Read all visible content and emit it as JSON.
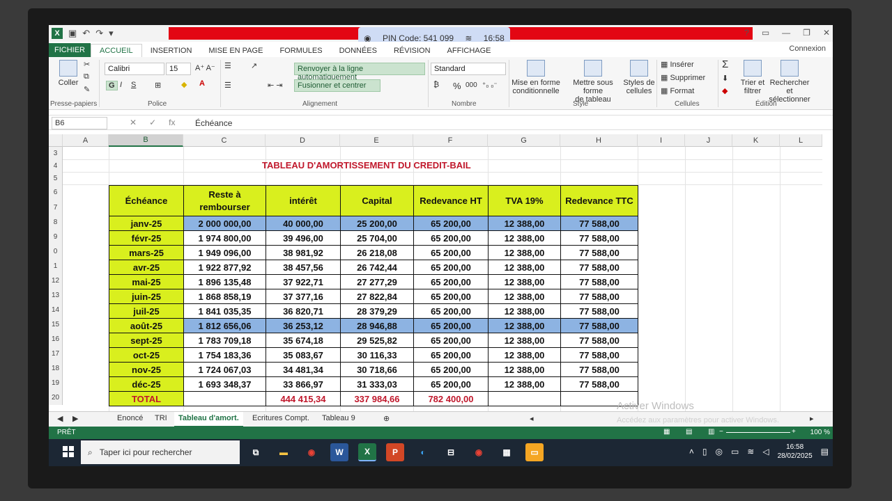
{
  "titlebar": {
    "pin_code": "PIN Code: 541 099",
    "pin_time": "16:58"
  },
  "tabs": [
    {
      "label": "FICHIER"
    },
    {
      "label": "ACCUEIL"
    },
    {
      "label": "INSERTION"
    },
    {
      "label": "MISE EN PAGE"
    },
    {
      "label": "FORMULES"
    },
    {
      "label": "DONNÉES"
    },
    {
      "label": "RÉVISION"
    },
    {
      "label": "AFFICHAGE"
    }
  ],
  "connexion": "Connexion",
  "ribbon": {
    "paste": "Coller",
    "clipboard": "Presse-papiers",
    "font_name": "Calibri",
    "font_size": "15",
    "font_group": "Police",
    "bold": "G",
    "italic": "I",
    "underline": "S",
    "wrap_text": "Renvoyer à la ligne automatiquement",
    "merge_center": "Fusionner et centrer",
    "alignment_group": "Alignement",
    "number_format": "Standard",
    "percent": "%",
    "thousands": "000",
    "number_group": "Nombre",
    "cond_format_1": "Mise en forme",
    "cond_format_2": "conditionnelle",
    "as_table_1": "Mettre sous forme",
    "as_table_2": "de tableau",
    "cell_styles_1": "Styles de",
    "cell_styles_2": "cellules",
    "style_group": "Style",
    "insert": "Insérer",
    "delete": "Supprimer",
    "format": "Format",
    "cells_group": "Cellules",
    "sort_1": "Trier et",
    "sort_2": "filtrer",
    "find_1": "Rechercher et",
    "find_2": "sélectionner",
    "edit_group": "Édition"
  },
  "formula_bar": {
    "cell_ref": "B6",
    "content": "Échéance"
  },
  "columns": [
    "A",
    "B",
    "C",
    "D",
    "E",
    "F",
    "G",
    "H",
    "I",
    "J",
    "K",
    "L"
  ],
  "rows": [
    "3",
    "4",
    "5",
    "6",
    "7",
    "8",
    "9",
    "0",
    "1",
    "12",
    "13",
    "14",
    "15",
    "16",
    "17",
    "18",
    "19",
    "20"
  ],
  "sheet_title": "TABLEAU D'AMORTISSEMENT DU CREDIT-BAIL",
  "table": {
    "headers": [
      "Échéance",
      "Reste à rembourser",
      "intérêt",
      "Capital",
      "Redevance HT",
      "TVA 19%",
      "Redevance TTC"
    ],
    "rows": [
      [
        "janv-25",
        "2 000 000,00",
        "40 000,00",
        "25 200,00",
        "65 200,00",
        "12 388,00",
        "77 588,00"
      ],
      [
        "févr-25",
        "1 974 800,00",
        "39 496,00",
        "25 704,00",
        "65 200,00",
        "12 388,00",
        "77 588,00"
      ],
      [
        "mars-25",
        "1 949 096,00",
        "38 981,92",
        "26 218,08",
        "65 200,00",
        "12 388,00",
        "77 588,00"
      ],
      [
        "avr-25",
        "1 922 877,92",
        "38 457,56",
        "26 742,44",
        "65 200,00",
        "12 388,00",
        "77 588,00"
      ],
      [
        "mai-25",
        "1 896 135,48",
        "37 922,71",
        "27 277,29",
        "65 200,00",
        "12 388,00",
        "77 588,00"
      ],
      [
        "juin-25",
        "1 868 858,19",
        "37 377,16",
        "27 822,84",
        "65 200,00",
        "12 388,00",
        "77 588,00"
      ],
      [
        "juil-25",
        "1 841 035,35",
        "36 820,71",
        "28 379,29",
        "65 200,00",
        "12 388,00",
        "77 588,00"
      ],
      [
        "août-25",
        "1 812 656,06",
        "36 253,12",
        "28 946,88",
        "65 200,00",
        "12 388,00",
        "77 588,00"
      ],
      [
        "sept-25",
        "1 783 709,18",
        "35 674,18",
        "29 525,82",
        "65 200,00",
        "12 388,00",
        "77 588,00"
      ],
      [
        "oct-25",
        "1 754 183,36",
        "35 083,67",
        "30 116,33",
        "65 200,00",
        "12 388,00",
        "77 588,00"
      ],
      [
        "nov-25",
        "1 724 067,03",
        "34 481,34",
        "30 718,66",
        "65 200,00",
        "12 388,00",
        "77 588,00"
      ],
      [
        "déc-25",
        "1 693 348,37",
        "33 866,97",
        "31 333,03",
        "65 200,00",
        "12 388,00",
        "77 588,00"
      ]
    ],
    "total": [
      "TOTAL",
      "",
      "444 415,34",
      "337 984,66",
      "782 400,00",
      "",
      ""
    ]
  },
  "sheet_tabs": [
    "Enoncé",
    "TRI",
    "Tableau d'amort.",
    "Ecritures Compt.",
    "Tableau 9"
  ],
  "watermark": {
    "line1": "Activer Windows",
    "line2": "Accédez aux paramètres pour activer Windows."
  },
  "status": {
    "ready": "PRÊT",
    "zoom": "100 %"
  },
  "taskbar": {
    "search_placeholder": "Taper ici pour rechercher",
    "time": "16:58",
    "date": "28/02/2025"
  },
  "colors": {
    "excel_green": "#217346",
    "header_yellow": "#d9ef1e",
    "highlight_blue": "#8db3e2",
    "title_red": "#c0172b"
  }
}
